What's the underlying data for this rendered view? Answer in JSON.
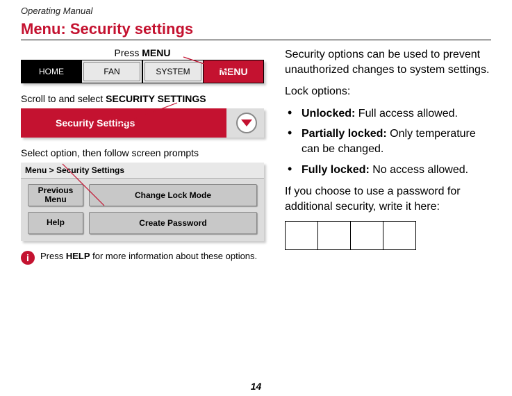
{
  "header": "Operating Manual",
  "title": "Menu: Security settings",
  "step1": {
    "press_prefix": "Press ",
    "press_bold": "MENU",
    "tabs": {
      "home": "HOME",
      "fan": "FAN",
      "system": "SYSTEM",
      "menu": "MENU"
    }
  },
  "step2": {
    "label_prefix": "Scroll to and select ",
    "label_bold": "SECURITY SETTINGS",
    "panel_text": "Security Settings"
  },
  "step3": {
    "label": "Select option, then follow screen prompts",
    "breadcrumb": "Menu > Security Settings",
    "buttons": {
      "prev_line1": "Previous",
      "prev_line2": "Menu",
      "change": "Change Lock Mode",
      "help": "Help",
      "create": "Create Password"
    }
  },
  "info": {
    "prefix": "Press ",
    "bold": "HELP",
    "suffix": " for more information about these options."
  },
  "right": {
    "intro": "Security options can be used to prevent unauthorized changes to system settings.",
    "lock_label": "Lock options:",
    "opts": [
      {
        "name": "Unlocked:",
        "desc": " Full access allowed."
      },
      {
        "name": "Partially locked:",
        "desc": " Only temperature can be changed."
      },
      {
        "name": "Fully locked:",
        "desc": " No access allowed."
      }
    ],
    "pw_note": "If you choose to use a password for additional security, write it here:"
  },
  "page_number": "14"
}
